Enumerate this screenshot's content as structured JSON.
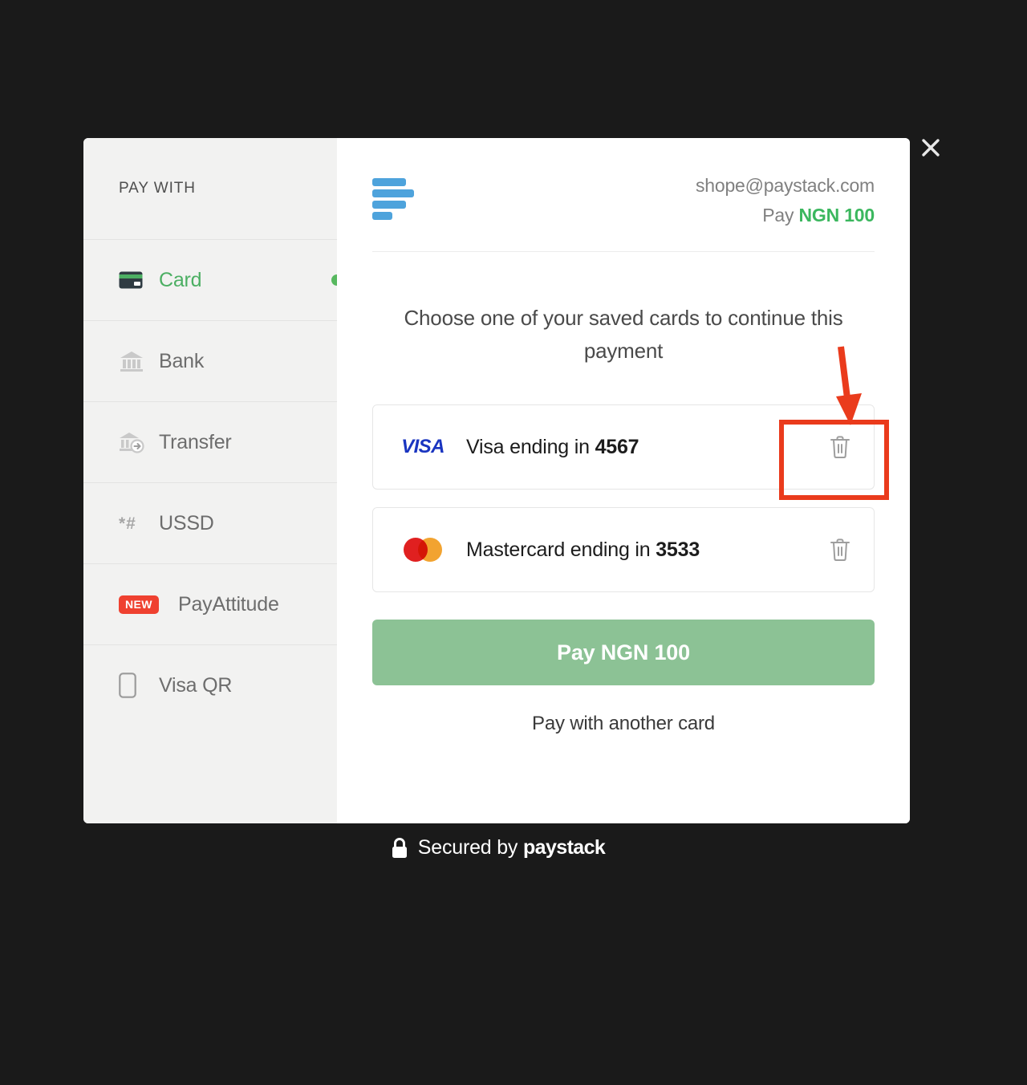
{
  "window": {
    "background_color": "#1a1a1a",
    "close_label": "×",
    "close_icon": "close-icon"
  },
  "sidebar": {
    "title": "PAY WITH",
    "items": [
      {
        "label": "Card",
        "icon": "credit-card-icon",
        "active": true,
        "badge": null
      },
      {
        "label": "Bank",
        "icon": "bank-icon",
        "active": false,
        "badge": null
      },
      {
        "label": "Transfer",
        "icon": "bank-transfer-icon",
        "active": false,
        "badge": null
      },
      {
        "label": "USSD",
        "icon": "ussd-hash-icon",
        "active": false,
        "badge": null
      },
      {
        "label": "PayAttitude",
        "icon": "new-badge-icon",
        "active": false,
        "badge": "NEW"
      },
      {
        "label": "Visa QR",
        "icon": "phone-qr-icon",
        "active": false,
        "badge": null
      }
    ]
  },
  "header": {
    "logo_icon": "paystack-bars-logo",
    "merchant_email": "shope@paystack.com",
    "pay_prefix": "Pay",
    "pay_amount": "NGN 100"
  },
  "main": {
    "prompt": "Choose one of your saved cards to continue this payment",
    "saved_cards": [
      {
        "brand": "VISA",
        "brand_icon": "visa-logo",
        "text_prefix": "Visa ending in ",
        "last4": "4567",
        "delete_icon": "trash-icon",
        "highlighted": true
      },
      {
        "brand": "Mastercard",
        "brand_icon": "mastercard-logo",
        "text_prefix": "Mastercard ending in ",
        "last4": "3533",
        "delete_icon": "trash-icon",
        "highlighted": false
      }
    ],
    "pay_button_label": "Pay NGN 100",
    "alt_link_label": "Pay with another card"
  },
  "footer": {
    "lock_icon": "lock-icon",
    "secured_prefix": "Secured by ",
    "brand": "paystack"
  },
  "annotation": {
    "color": "#ea3b1c",
    "arrow_icon": "down-arrow-annotation",
    "target": "delete-visa-card-button"
  },
  "colors": {
    "accent_green": "#3bb75e",
    "button_green": "#8cc295",
    "annotation_red": "#ea3b1c",
    "badge_red": "#ef4130",
    "logo_blue": "#4ea3dc",
    "visa_blue": "#1a35c0",
    "sidebar_gray": "#f2f2f1"
  }
}
